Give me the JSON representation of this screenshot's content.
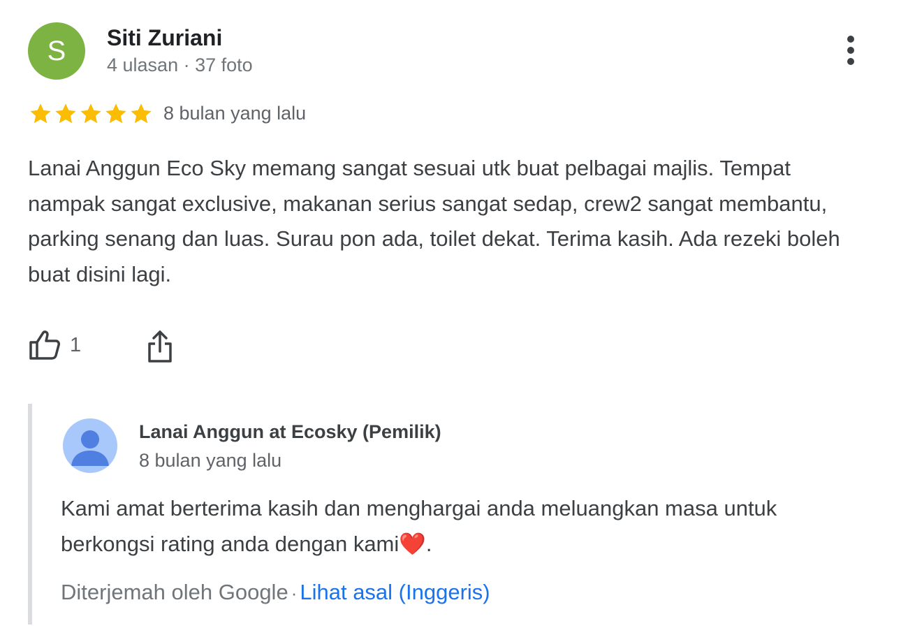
{
  "reviewer": {
    "initial": "S",
    "avatar_color": "#7cb342",
    "name": "Siti Zuriani",
    "meta": "4 ulasan · 37 foto"
  },
  "review": {
    "rating": 5,
    "max_rating": 5,
    "star_color": "#fbbc04",
    "time": "8 bulan yang lalu",
    "text": "Lanai Anggun Eco Sky memang sangat sesuai utk buat pelbagai majlis. Tempat nampak sangat exclusive, makanan serius sangat sedap, crew2 sangat membantu, parking senang dan luas. Surau pon ada, toilet dekat. Terima kasih. Ada rezeki boleh buat disini lagi."
  },
  "actions": {
    "like_icon": "thumbs-up-icon",
    "like_count": "1",
    "share_icon": "share-icon",
    "more_icon": "more-vert-icon"
  },
  "owner_reply": {
    "avatar_icon": "person-icon",
    "avatar_color": "#a8c7fa",
    "name": "Lanai Anggun at Ecosky (Pemilik)",
    "time": "8 bulan yang lalu",
    "text": "Kami amat berterima kasih dan menghargai anda meluangkan masa untuk berkongsi rating anda dengan kami❤️.",
    "translated_label": "Diterjemah oleh Google",
    "separator": "·",
    "view_original_label": "Lihat asal (Inggeris)",
    "link_color": "#1a73e8"
  }
}
